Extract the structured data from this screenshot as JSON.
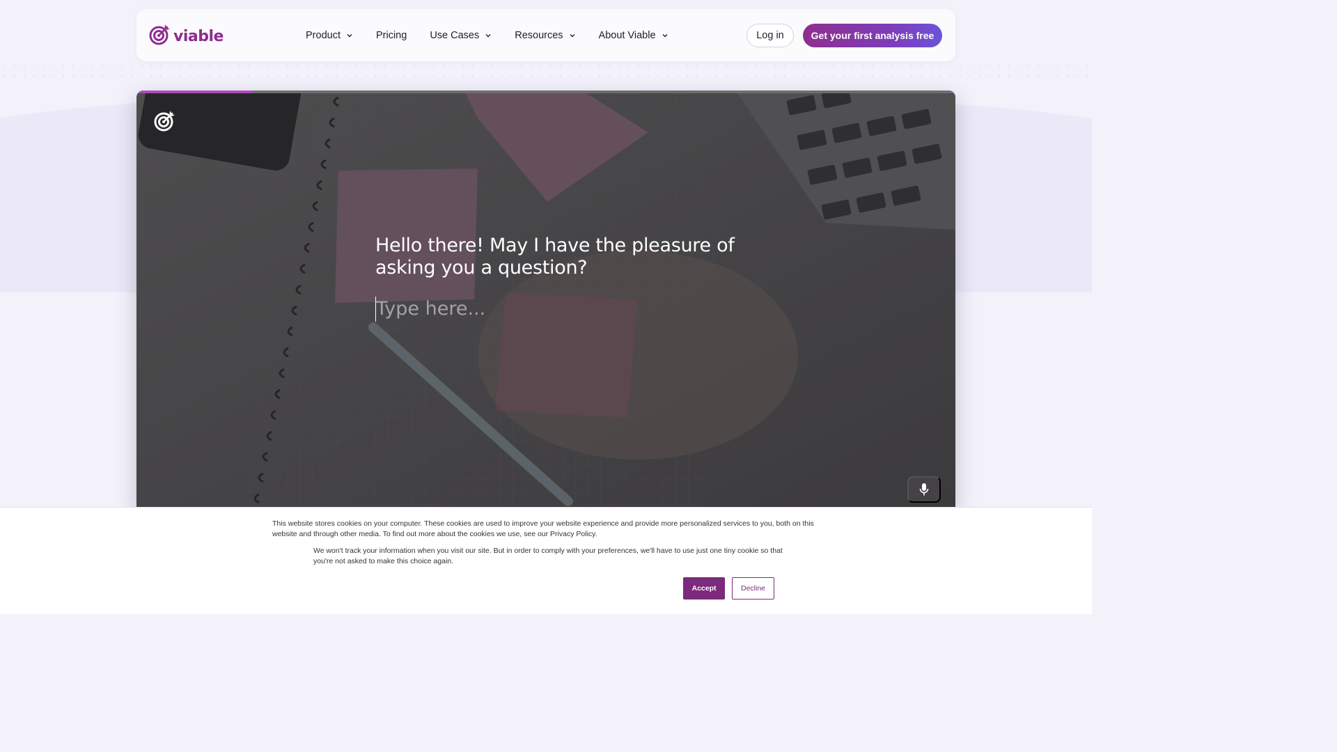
{
  "brand": {
    "name": "viable",
    "color": "#8e2c8f"
  },
  "nav": {
    "items": [
      {
        "label": "Product",
        "has_dropdown": true
      },
      {
        "label": "Pricing",
        "has_dropdown": false
      },
      {
        "label": "Use Cases",
        "has_dropdown": true
      },
      {
        "label": "Resources",
        "has_dropdown": true
      },
      {
        "label": "About Viable",
        "has_dropdown": true
      }
    ],
    "login_label": "Log in",
    "cta_label": "Get your first analysis free"
  },
  "survey": {
    "question": "Hello there! May I have the pleasure of asking you a question?",
    "answer_placeholder": "Type here...",
    "progress": 0.14,
    "mic_icon": "microphone-icon"
  },
  "cookie_banner": {
    "text_main": "This website stores cookies on your computer. These cookies are used to improve your website experience and provide more personalized services to you, both on this website and through other media. To find out more about the cookies we use, see our Privacy Policy.",
    "text_secondary": "We won't track your information when you visit our site. But in order to comply with your preferences, we'll have to use just one tiny cookie so that you're not asked to make this choice again.",
    "accept_label": "Accept",
    "decline_label": "Decline",
    "accent_color": "#7b2a7c"
  }
}
